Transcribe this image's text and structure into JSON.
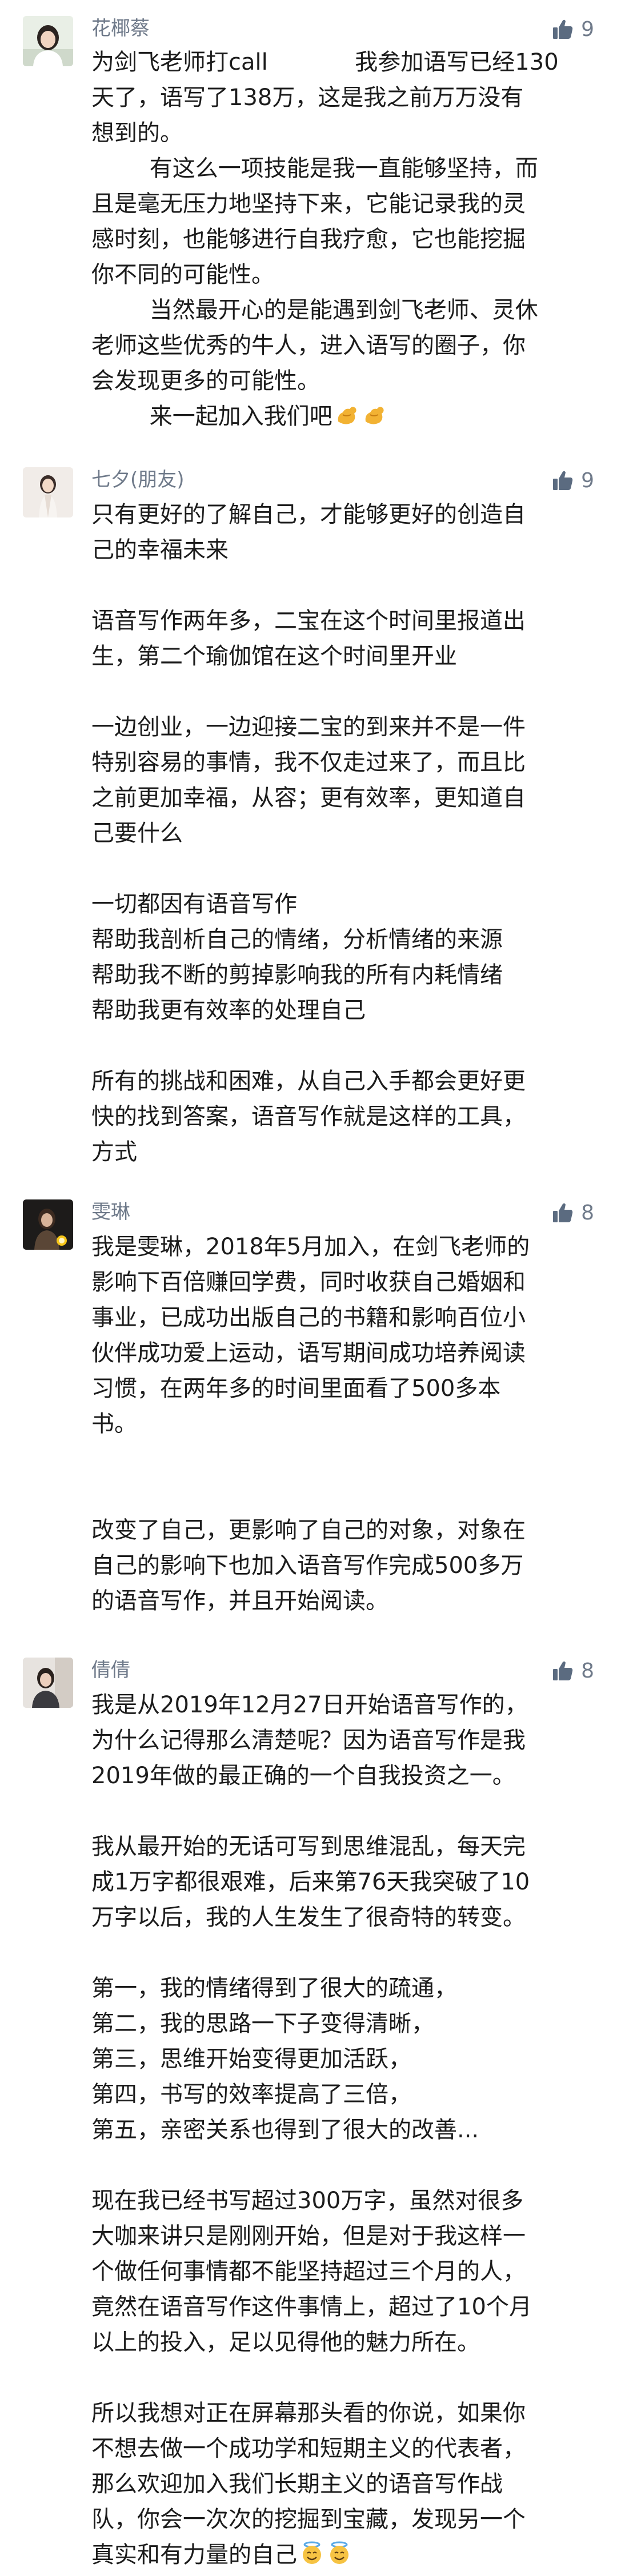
{
  "comments": [
    {
      "author": "花椰蔡",
      "likes": "9",
      "avatar_icon": "avatar-woman-photo",
      "lines": [
        "为剑飞老师打call            我参加语写已经130",
        "天了，语写了138万，这是我之前万万没有",
        "想到的。",
        "        有这么一项技能是我一直能够坚持，而",
        "且是毫无压力地坚持下来，它能记录我的灵",
        "感时刻，也能够进行自我疗愈，它也能挖掘",
        "你不同的可能性。",
        "        当然最开心的是能遇到剑飞老师、灵休",
        "老师这些优秀的牛人，进入语写的圈子，你",
        "会发现更多的可能性。",
        "        来一起加入我们吧"
      ],
      "emoji_icons": [
        "flexed-biceps-emoji",
        "flexed-biceps-emoji"
      ]
    },
    {
      "author": "七夕(朋友)",
      "likes": "9",
      "avatar_icon": "avatar-woman-photo",
      "lines": [
        "只有更好的了解自己，才能够更好的创造自",
        "己的幸福未来",
        "",
        "语音写作两年多，二宝在这个时间里报道出",
        "生，第二个瑜伽馆在这个时间里开业",
        "",
        "一边创业，一边迎接二宝的到来并不是一件",
        "特别容易的事情，我不仅走过来了，而且比",
        "之前更加幸福，从容；更有效率，更知道自",
        "己要什么",
        "",
        "一切都因有语音写作",
        "帮助我剖析自己的情绪，分析情绪的来源",
        "帮助我不断的剪掉影响我的所有内耗情绪",
        "帮助我更有效率的处理自己",
        "",
        "所有的挑战和困难，从自己入手都会更好更",
        "快的找到答案，语音写作就是这样的工具，",
        "方式"
      ]
    },
    {
      "author": "雯琳",
      "likes": "8",
      "avatar_icon": "avatar-woman-dark-photo",
      "lines": [
        "我是雯琳，2018年5月加入，在剑飞老师的",
        "影响下百倍赚回学费，同时收获自己婚姻和",
        "事业，已成功出版自己的书籍和影响百位小",
        "伙伴成功爱上运动，语写期间成功培养阅读",
        "习惯，在两年多的时间里面看了500多本",
        "书。",
        "",
        "",
        "改变了自己，更影响了自己的对象，对象在",
        "自己的影响下也加入语音写作完成500多万",
        "的语音写作，并且开始阅读。"
      ]
    },
    {
      "author": "倩倩",
      "likes": "8",
      "avatar_icon": "avatar-woman-photo",
      "lines": [
        "我是从2019年12月27日开始语音写作的，",
        "为什么记得那么清楚呢？因为语音写作是我",
        "2019年做的最正确的一个自我投资之一。",
        "",
        "我从最开始的无话可写到思维混乱，每天完",
        "成1万字都很艰难，后来第76天我突破了10",
        "万字以后，我的人生发生了很奇特的转变。",
        "",
        "第一，我的情绪得到了很大的疏通，",
        "第二，我的思路一下子变得清晰，",
        "第三，思维开始变得更加活跃，",
        "第四，书写的效率提高了三倍，",
        "第五，亲密关系也得到了很大的改善...",
        "",
        "现在我已经书写超过300万字，虽然对很多",
        "大咖来讲只是刚刚开始，但是对于我这样一",
        "个做任何事情都不能坚持超过三个月的人，",
        "竟然在语音写作这件事情上，超过了10个月",
        "以上的投入，足以见得他的魅力所在。",
        "",
        "所以我想对正在屏幕那头看的你说，如果你",
        "不想去做一个成功学和短期主义的代表者，",
        "那么欢迎加入我们长期主义的语音写作战",
        "队，你会一次次的挖掘到宝藏，发现另一个",
        "真实和有力量的自己"
      ],
      "emoji_icons": [
        "smiling-face-with-halo-emoji",
        "smiling-face-with-halo-emoji"
      ]
    }
  ]
}
